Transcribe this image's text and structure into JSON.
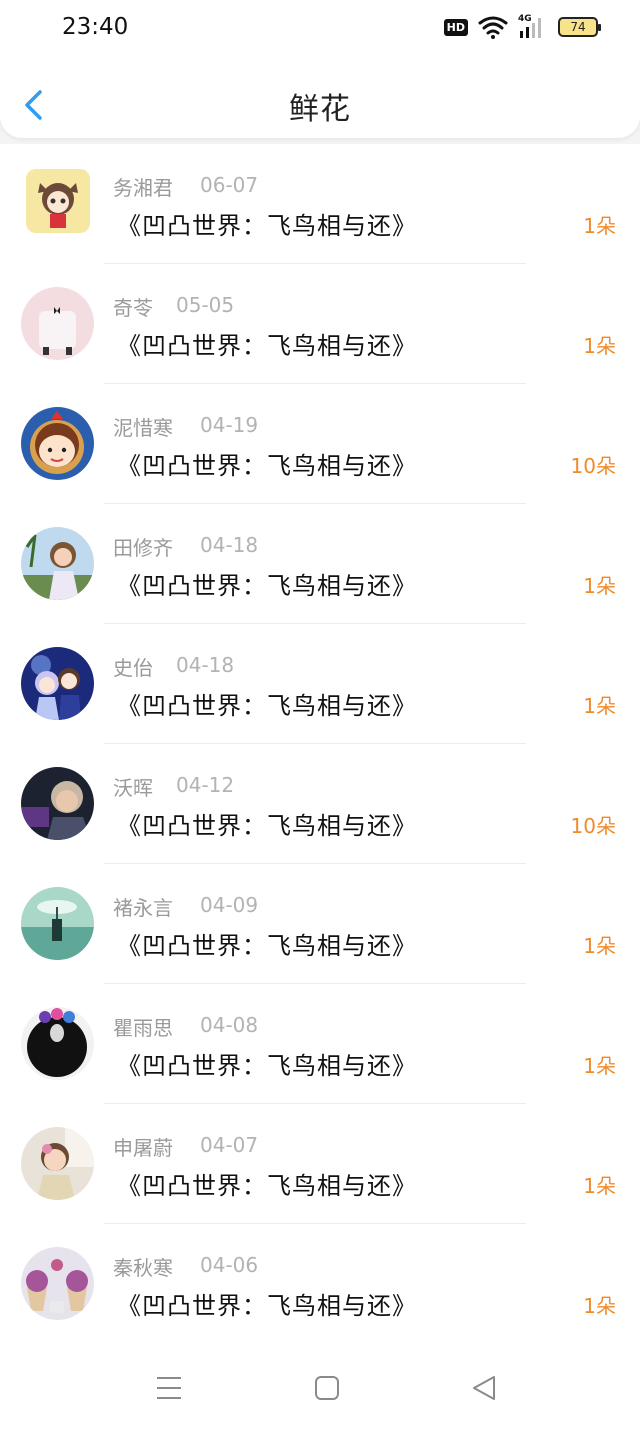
{
  "status_bar": {
    "time": "23:40",
    "hd": "HD",
    "network": "4G",
    "battery": "74"
  },
  "header": {
    "title": "鲜花"
  },
  "colors": {
    "accent_blue": "#2f9cf2",
    "amount_orange": "#f08a2a"
  },
  "items": [
    {
      "name": "务湘君",
      "date": "06-07",
      "book": "《凹凸世界：飞鸟相与还》",
      "amount": "1朵"
    },
    {
      "name": "奇苓",
      "date": "05-05",
      "book": "《凹凸世界：飞鸟相与还》",
      "amount": "1朵"
    },
    {
      "name": "泥惜寒",
      "date": "04-19",
      "book": "《凹凸世界：飞鸟相与还》",
      "amount": "10朵"
    },
    {
      "name": "田修齐",
      "date": "04-18",
      "book": "《凹凸世界：飞鸟相与还》",
      "amount": "1朵"
    },
    {
      "name": "史佁",
      "date": "04-18",
      "book": "《凹凸世界：飞鸟相与还》",
      "amount": "1朵"
    },
    {
      "name": "沃晖",
      "date": "04-12",
      "book": "《凹凸世界：飞鸟相与还》",
      "amount": "10朵"
    },
    {
      "name": "褚永言",
      "date": "04-09",
      "book": "《凹凸世界：飞鸟相与还》",
      "amount": "1朵"
    },
    {
      "name": "瞿雨思",
      "date": "04-08",
      "book": "《凹凸世界：飞鸟相与还》",
      "amount": "1朵"
    },
    {
      "name": "申屠蔚",
      "date": "04-07",
      "book": "《凹凸世界：飞鸟相与还》",
      "amount": "1朵"
    },
    {
      "name": "秦秋寒",
      "date": "04-06",
      "book": "《凹凸世界：飞鸟相与还》",
      "amount": "1朵"
    }
  ]
}
